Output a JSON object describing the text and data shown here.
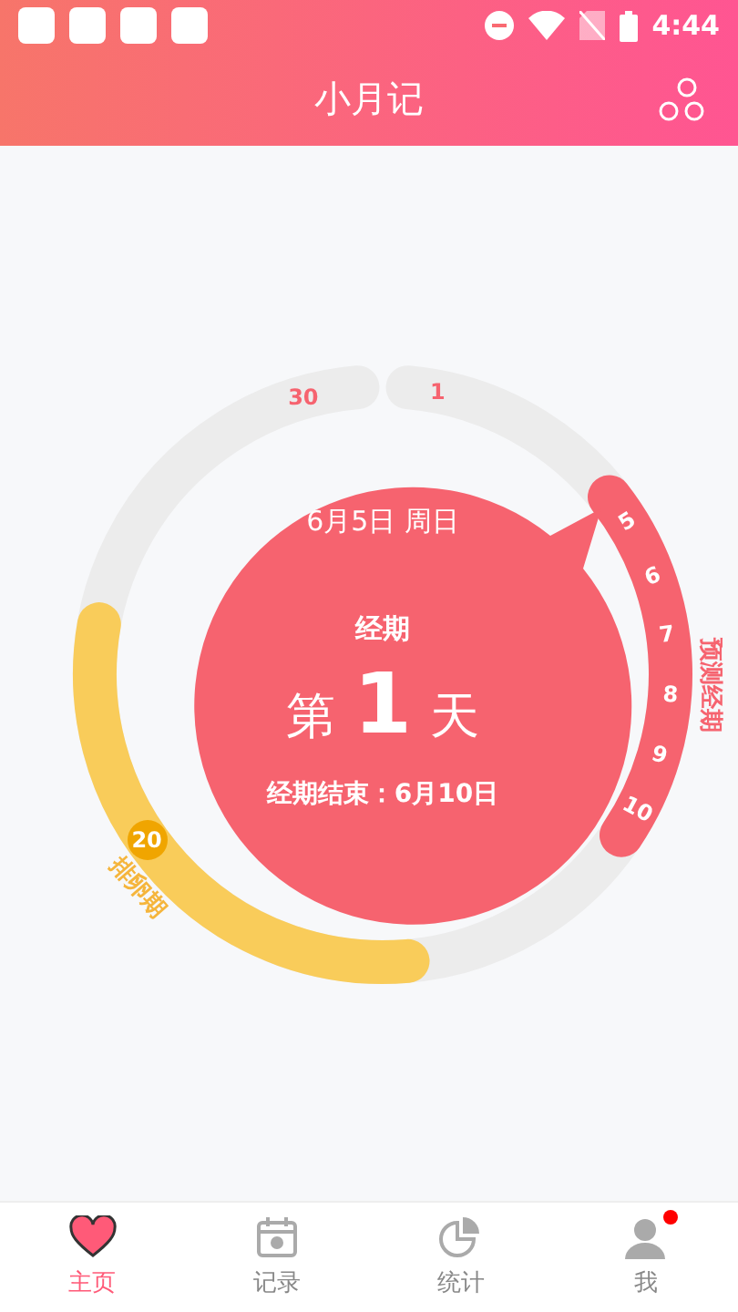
{
  "status_bar": {
    "time": "4:44"
  },
  "header": {
    "title": "小月记"
  },
  "dial": {
    "date": "6月5日 周日",
    "phase": "经期",
    "day_prefix": "第",
    "day_number": "1",
    "day_suffix": "天",
    "end_note": "经期结束：6月10日",
    "top_days": [
      "30",
      "1"
    ],
    "period_days": [
      "5",
      "6",
      "7",
      "8",
      "9",
      "10"
    ],
    "period_label": "预测经期",
    "ovulation": {
      "day": "20",
      "label": "排卵期"
    }
  },
  "nav": [
    {
      "label": "主页",
      "selected": true,
      "kind": "home"
    },
    {
      "label": "记录",
      "selected": false,
      "kind": "record"
    },
    {
      "label": "统计",
      "selected": false,
      "kind": "stats"
    },
    {
      "label": "我",
      "selected": false,
      "kind": "me",
      "notification": true
    }
  ]
}
